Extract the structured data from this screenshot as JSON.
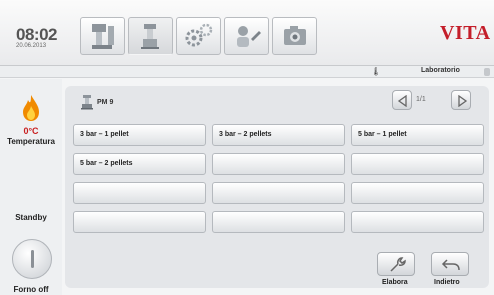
{
  "header": {
    "time": "08:02",
    "date": "20.06.2013",
    "brand": "VITA",
    "tabs": [
      {
        "icon": "furnace-icon"
      },
      {
        "icon": "press-icon"
      },
      {
        "icon": "settings-gears-icon"
      },
      {
        "icon": "service-icon"
      },
      {
        "icon": "camera-icon"
      }
    ]
  },
  "status": {
    "lab_label": "Laboratorio",
    "icon": "thermometer-icon"
  },
  "sidebar": {
    "temp_value": "0°C",
    "temp_label": "Temperatura",
    "standby_label": "Standby",
    "power_label": "Forno off"
  },
  "program_list": {
    "group_label": "PM 9",
    "page_indicator": "1/1",
    "buttons": [
      "3 bar – 1 pellet",
      "3 bar – 2 pellets",
      "5 bar – 1 pellet",
      "5 bar – 2 pellets",
      "",
      "",
      "",
      "",
      "",
      "",
      "",
      ""
    ]
  },
  "actions": {
    "edit_label": "Elabora",
    "back_label": "Indietro"
  },
  "colors": {
    "brand": "#c41e2a",
    "temperature": "#c81e1e",
    "flame": "#f08a00"
  }
}
